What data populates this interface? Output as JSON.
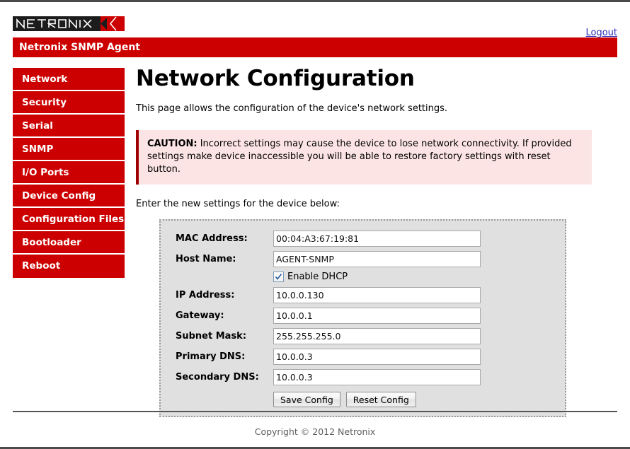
{
  "header": {
    "logo_text": "NETRONIX",
    "logout_label": "Logout",
    "banner_title": "Netronix SNMP Agent"
  },
  "sidebar": {
    "items": [
      {
        "label": "Network"
      },
      {
        "label": "Security"
      },
      {
        "label": "Serial"
      },
      {
        "label": "SNMP"
      },
      {
        "label": "I/O Ports"
      },
      {
        "label": "Device Config"
      },
      {
        "label": "Configuration Files"
      },
      {
        "label": "Bootloader"
      },
      {
        "label": "Reboot"
      }
    ]
  },
  "main": {
    "title": "Network Configuration",
    "intro": "This page allows the configuration of the device's network settings.",
    "caution": {
      "prefix": "CAUTION:",
      "text": " Incorrect settings may cause the device to lose network connectivity. If provided settings make device inaccessible you will be able to restore factory settings with reset button."
    },
    "enter_settings": "Enter the new settings for the device below:",
    "form": {
      "mac_address": {
        "label": "MAC Address:",
        "value": "00:04:A3:67:19:81"
      },
      "host_name": {
        "label": "Host Name:",
        "value": "AGENT-SNMP"
      },
      "enable_dhcp": {
        "label": "Enable DHCP",
        "checked": true
      },
      "ip_address": {
        "label": "IP Address:",
        "value": "10.0.0.130"
      },
      "gateway": {
        "label": "Gateway:",
        "value": "10.0.0.1"
      },
      "subnet_mask": {
        "label": "Subnet Mask:",
        "value": "255.255.255.0"
      },
      "primary_dns": {
        "label": "Primary DNS:",
        "value": "10.0.0.3"
      },
      "secondary_dns": {
        "label": "Secondary DNS:",
        "value": "10.0.0.3"
      },
      "save_button": "Save Config",
      "reset_button": "Reset Config"
    }
  },
  "footer": {
    "copyright": "Copyright © 2012 Netronix"
  },
  "colors": {
    "brand_red": "#cc0000",
    "caution_bg": "#fce4e4",
    "caution_border": "#a00000",
    "panel_bg": "#e0e0e0",
    "link": "#2b2bbb"
  }
}
